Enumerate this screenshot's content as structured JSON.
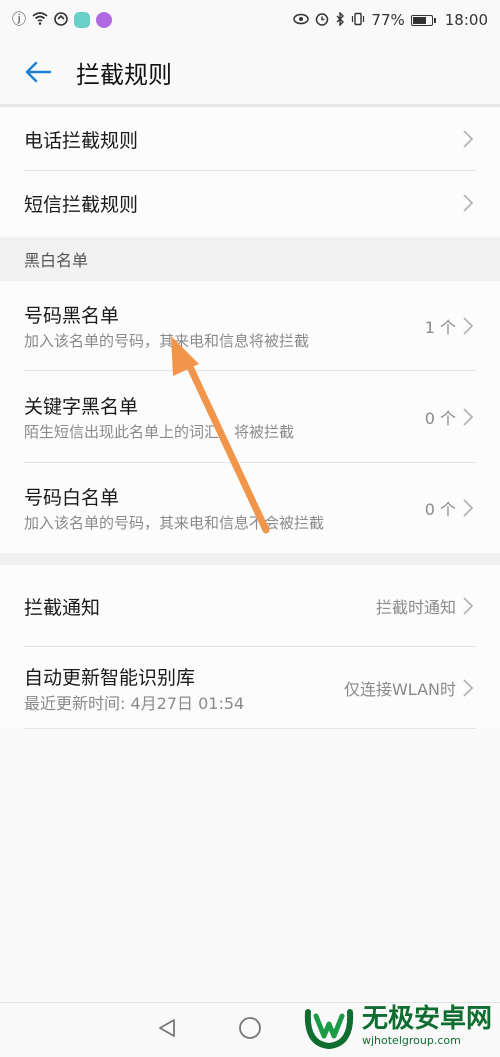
{
  "status": {
    "battery": "77%",
    "time": "18:00",
    "battery_level": 0.77,
    "icons_left": [
      "alert-icon",
      "wifi-icon",
      "sync-icon",
      "app-badge-icon",
      "app-icon"
    ],
    "icons_right": [
      "eye-icon",
      "alarm-icon",
      "bluetooth-icon",
      "vibrate-icon"
    ]
  },
  "header": {
    "title": "拦截规则"
  },
  "rules": [
    {
      "label": "电话拦截规则"
    },
    {
      "label": "短信拦截规则"
    }
  ],
  "lists_section": {
    "heading": "黑白名单",
    "items": [
      {
        "title": "号码黑名单",
        "subtitle": "加入该名单的号码，其来电和信息将被拦截",
        "count": "1 个"
      },
      {
        "title": "关键字黑名单",
        "subtitle": "陌生短信出现此名单上的词汇，将被拦截",
        "count": "0 个"
      },
      {
        "title": "号码白名单",
        "subtitle": "加入该名单的号码，其来电和信息不会被拦截",
        "count": "0 个"
      }
    ]
  },
  "notify": {
    "title": "拦截通知",
    "value": "拦截时通知"
  },
  "update": {
    "title": "自动更新智能识别库",
    "subtitle": "最近更新时间: 4月27日 01:54",
    "value": "仅连接WLAN时"
  },
  "watermark": {
    "big": "无极安卓网",
    "small": "wjhotelgroup.com"
  },
  "colors": {
    "accent": "#1d7fd6",
    "arrow": "#f0954a",
    "watermark_green": "#0e6d2f"
  }
}
